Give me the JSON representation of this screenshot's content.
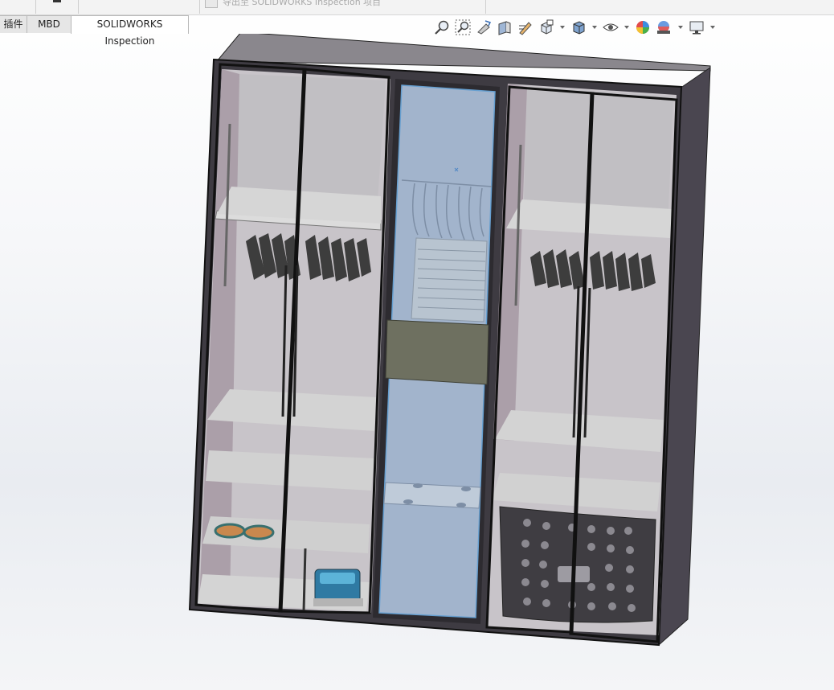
{
  "toolbar_strip": {
    "command_text": "导出至 SOLIDWORKS Inspection 项目"
  },
  "tabs": [
    {
      "label": "插件",
      "active": false
    },
    {
      "label": "MBD",
      "active": false
    },
    {
      "label": "SOLIDWORKS Inspection",
      "active": true
    }
  ],
  "view_toolbar": {
    "icons": [
      "zoom-to-fit-icon",
      "zoom-to-area-icon",
      "previous-view-icon",
      "section-view-icon",
      "dynamic-annotation-icon",
      "view-orientation-icon",
      "display-style-icon",
      "hide-show-items-icon",
      "edit-appearance-icon",
      "apply-scene-icon",
      "view-settings-icon"
    ]
  },
  "colors": {
    "selection_blue": "#a7bbd6",
    "cabinet_frame": "#4d4a51",
    "interior_panel": "#c9c9cb",
    "shelf": "#dcdcdc",
    "drawer_green": "#6e7060"
  }
}
